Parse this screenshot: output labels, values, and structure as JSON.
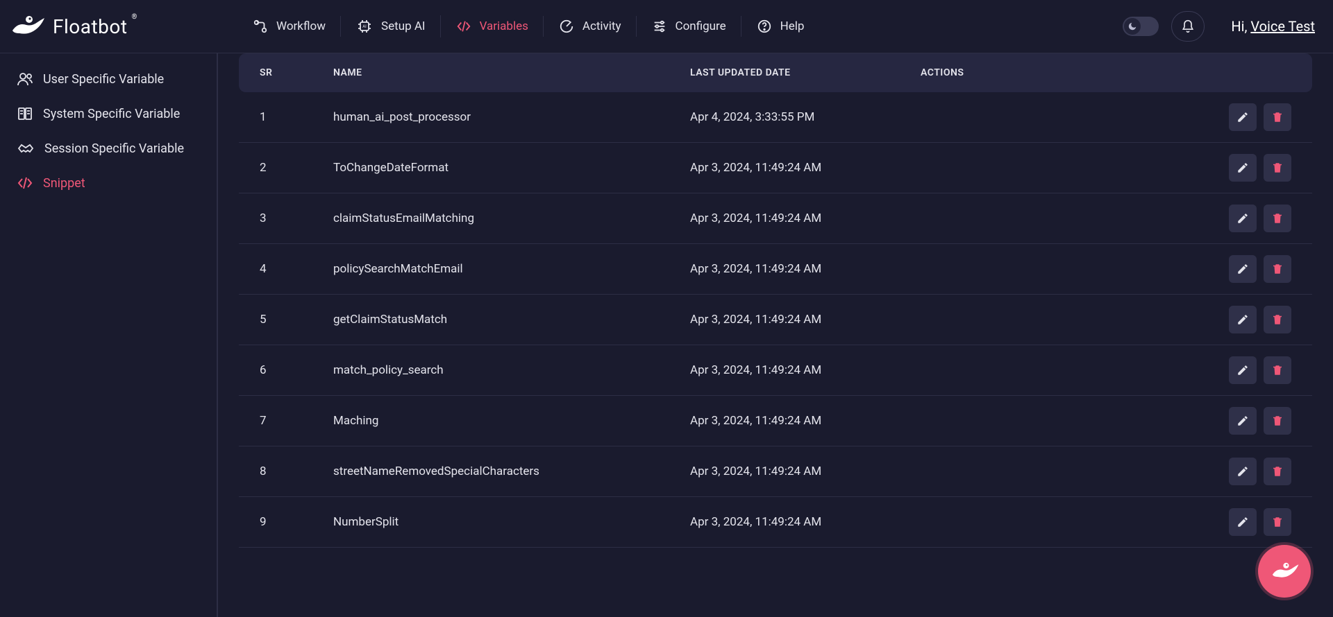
{
  "brand": {
    "name": "Floatbot"
  },
  "topnav": [
    {
      "key": "workflow",
      "label": "Workflow"
    },
    {
      "key": "setup-ai",
      "label": "Setup AI"
    },
    {
      "key": "variables",
      "label": "Variables",
      "active": true
    },
    {
      "key": "activity",
      "label": "Activity"
    },
    {
      "key": "configure",
      "label": "Configure"
    },
    {
      "key": "help",
      "label": "Help"
    }
  ],
  "greeting": {
    "prefix": "Hi, ",
    "name": "Voice Test"
  },
  "sidebar": [
    {
      "key": "user-var",
      "label": "User Specific Variable"
    },
    {
      "key": "system-var",
      "label": "System Specific Variable"
    },
    {
      "key": "session-var",
      "label": "Session Specific Variable"
    },
    {
      "key": "snippet",
      "label": "Snippet",
      "active": true
    }
  ],
  "table": {
    "headers": {
      "sr": "SR",
      "name": "NAME",
      "date": "LAST UPDATED DATE",
      "actions": "ACTIONS"
    },
    "rows": [
      {
        "sr": "1",
        "name": "human_ai_post_processor",
        "date": "Apr 4, 2024, 3:33:55 PM"
      },
      {
        "sr": "2",
        "name": "ToChangeDateFormat",
        "date": "Apr 3, 2024, 11:49:24 AM"
      },
      {
        "sr": "3",
        "name": "claimStatusEmailMatching",
        "date": "Apr 3, 2024, 11:49:24 AM"
      },
      {
        "sr": "4",
        "name": "policySearchMatchEmail",
        "date": "Apr 3, 2024, 11:49:24 AM"
      },
      {
        "sr": "5",
        "name": "getClaimStatusMatch",
        "date": "Apr 3, 2024, 11:49:24 AM"
      },
      {
        "sr": "6",
        "name": "match_policy_search",
        "date": "Apr 3, 2024, 11:49:24 AM"
      },
      {
        "sr": "7",
        "name": "Maching",
        "date": "Apr 3, 2024, 11:49:24 AM"
      },
      {
        "sr": "8",
        "name": "streetNameRemovedSpecialCharacters",
        "date": "Apr 3, 2024, 11:49:24 AM"
      },
      {
        "sr": "9",
        "name": "NumberSplit",
        "date": "Apr 3, 2024, 11:49:24 AM"
      }
    ]
  }
}
